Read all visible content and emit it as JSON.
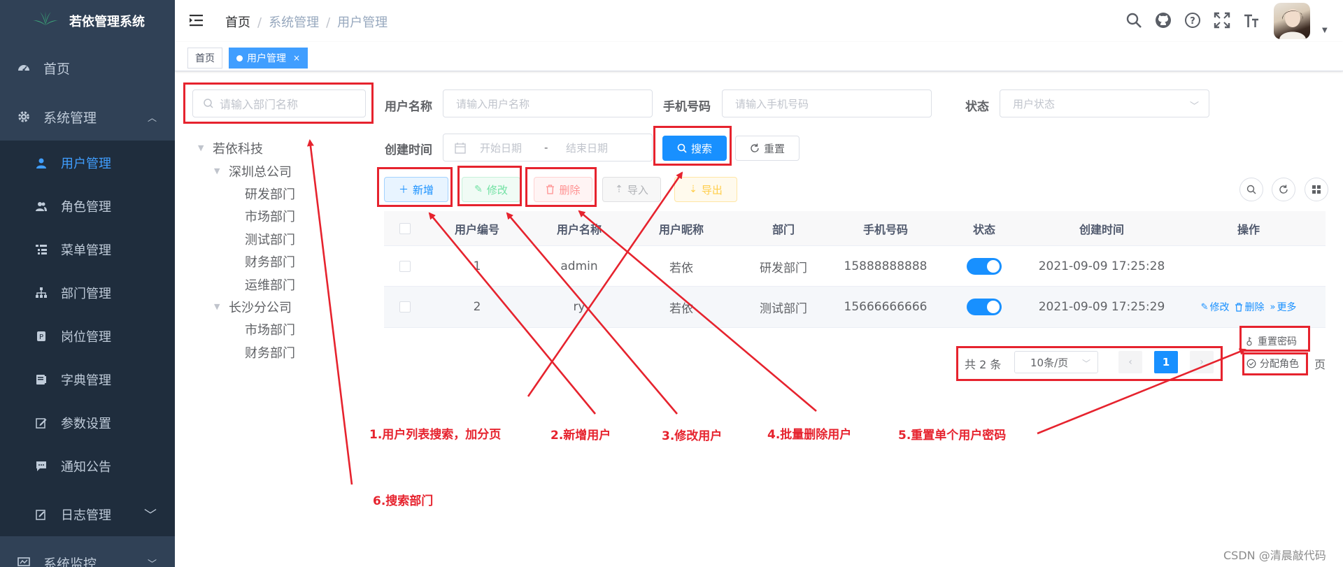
{
  "app": {
    "title": "若依管理系统"
  },
  "sidebar": {
    "items": [
      {
        "label": "首页",
        "icon": "dashboard-icon"
      },
      {
        "label": "系统管理",
        "icon": "system-gear-icon",
        "expanded": true
      },
      {
        "label": "日志管理",
        "icon": "log-icon"
      },
      {
        "label": "系统监控",
        "icon": "monitor-icon"
      }
    ],
    "sub_items": [
      {
        "label": "用户管理",
        "icon": "user-icon",
        "active": true
      },
      {
        "label": "角色管理",
        "icon": "peoples-icon"
      },
      {
        "label": "菜单管理",
        "icon": "tree-table-icon"
      },
      {
        "label": "部门管理",
        "icon": "tree-icon"
      },
      {
        "label": "岗位管理",
        "icon": "post-icon"
      },
      {
        "label": "字典管理",
        "icon": "dict-icon"
      },
      {
        "label": "参数设置",
        "icon": "edit-icon"
      },
      {
        "label": "通知公告",
        "icon": "message-icon"
      }
    ]
  },
  "navbar": {
    "breadcrumb": [
      "首页",
      "系统管理",
      "用户管理"
    ],
    "tools": [
      "search-icon",
      "github-icon",
      "question-icon",
      "fullscreen-icon",
      "font-size-icon"
    ]
  },
  "tags": {
    "home": "首页",
    "active": "用户管理",
    "close": "×"
  },
  "dept_tree": {
    "search_placeholder": "请输入部门名称",
    "root": "若依科技",
    "company1": "深圳总公司",
    "company1_children": [
      "研发部门",
      "市场部门",
      "测试部门",
      "财务部门",
      "运维部门"
    ],
    "company2": "长沙分公司",
    "company2_children": [
      "市场部门",
      "财务部门"
    ]
  },
  "search_form": {
    "username_label": "用户名称",
    "username_placeholder": "请输入用户名称",
    "phone_label": "手机号码",
    "phone_placeholder": "请输入手机号码",
    "status_label": "状态",
    "status_placeholder": "用户状态",
    "time_label": "创建时间",
    "start_placeholder": "开始日期",
    "range_sep": "-",
    "end_placeholder": "结束日期",
    "search_button": "搜索",
    "reset_button": "重置"
  },
  "toolbar": {
    "add": "新增",
    "edit": "修改",
    "delete": "删除",
    "import": "导入",
    "export": "导出"
  },
  "table": {
    "headers": [
      "用户编号",
      "用户名称",
      "用户昵称",
      "部门",
      "手机号码",
      "状态",
      "创建时间",
      "操作"
    ],
    "rows": [
      {
        "id": "1",
        "username": "admin",
        "nickname": "若依",
        "dept": "研发部门",
        "phone": "15888888888",
        "status_on": true,
        "created": "2021-09-09 17:25:28"
      },
      {
        "id": "2",
        "username": "ry",
        "nickname": "若依",
        "dept": "测试部门",
        "phone": "15666666666",
        "status_on": true,
        "created": "2021-09-09 17:25:29"
      }
    ],
    "ops": {
      "edit": "修改",
      "delete": "删除",
      "more": "更多"
    }
  },
  "more_menu": {
    "reset_pwd": "重置密码",
    "assign_role": "分配角色"
  },
  "pagination": {
    "total": "共 2 条",
    "page_size": "10条/页",
    "current_page": "1",
    "trailing": "页"
  },
  "annotations": {
    "a1": "1.用户列表搜索，加分页",
    "a2": "2.新增用户",
    "a3": "3.修改用户",
    "a4": "4.批量删除用户",
    "a5": "5.重置单个用户密码",
    "a6": "6.搜索部门"
  },
  "watermark": "CSDN @清晨敲代码",
  "colors": {
    "sidebar_bg": "#304156",
    "primary": "#1890ff",
    "annotation": "#e6232e"
  }
}
